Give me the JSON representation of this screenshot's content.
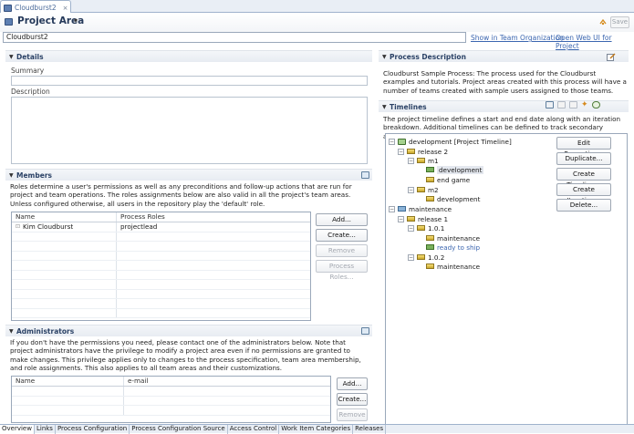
{
  "editor_tab": {
    "label": "Cloudburst2",
    "close": "×"
  },
  "header": {
    "title": "Project Area",
    "dropdown": "▾",
    "save_label": "Save"
  },
  "name_field": {
    "value": "Cloudburst2"
  },
  "links": {
    "show_in_team": "Show in Team Organization",
    "open_web": "Open Web UI for Project"
  },
  "details": {
    "title": "Details",
    "summary_label": "Summary",
    "summary_value": "",
    "description_label": "Description",
    "description_value": ""
  },
  "members": {
    "title": "Members",
    "intro": "Roles determine a user's permissions as well as any preconditions and follow-up actions that are run for project and team operations. The roles assignments below are also valid in all the project's team areas. Unless configured otherwise, all users in the repository play the 'default' role.",
    "columns": [
      "Name",
      "Process Roles"
    ],
    "rows": [
      {
        "name": "Kim Cloudburst",
        "roles": "projectlead"
      }
    ],
    "buttons": {
      "add": "Add...",
      "create": "Create...",
      "remove": "Remove",
      "process_roles": "Process Roles..."
    }
  },
  "administrators": {
    "title": "Administrators",
    "intro": "If you don't have the permissions you need, please contact one of the administrators below. Note that project administrators have the privilege to modify a project area even if no permissions are granted to make changes. This privilege applies only to changes to the process specification, team area membership, and role assignments. This also applies to all team areas and their customizations.",
    "columns": [
      "Name",
      "e-mail"
    ],
    "buttons": {
      "add": "Add...",
      "create": "Create...",
      "remove": "Remove"
    }
  },
  "process_description": {
    "title": "Process Description",
    "text": "Cloudburst Sample Process: The process used for the Cloudburst examples and tutorials. Project areas created with this process will have a number of teams created with sample users assigned to those teams."
  },
  "timelines": {
    "title": "Timelines",
    "intro": "The project timeline defines a start and end date along with an iteration breakdown. Additional timelines can be defined to track secondary activities.",
    "tree": {
      "development": "development [Project Timeline]",
      "release2": "release 2",
      "m1": "m1",
      "m1_development": "development",
      "m1_endgame": "end game",
      "m2": "m2",
      "m2_development": "development",
      "maintenance": "maintenance",
      "release1": "release 1",
      "v101": "1.0.1",
      "v101_maintenance": "maintenance",
      "v101_ready": "ready to ship",
      "v102": "1.0.2",
      "v102_maintenance": "maintenance"
    },
    "buttons": {
      "edit_properties": "Edit Properties...",
      "duplicate": "Duplicate...",
      "create_timeline": "Create Timeline...",
      "create_iteration": "Create Iteration...",
      "delete": "Delete..."
    }
  },
  "bottom_tabs": [
    "Overview",
    "Links",
    "Process Configuration",
    "Process Configuration Source",
    "Access Control",
    "Work Item Categories",
    "Releases"
  ]
}
